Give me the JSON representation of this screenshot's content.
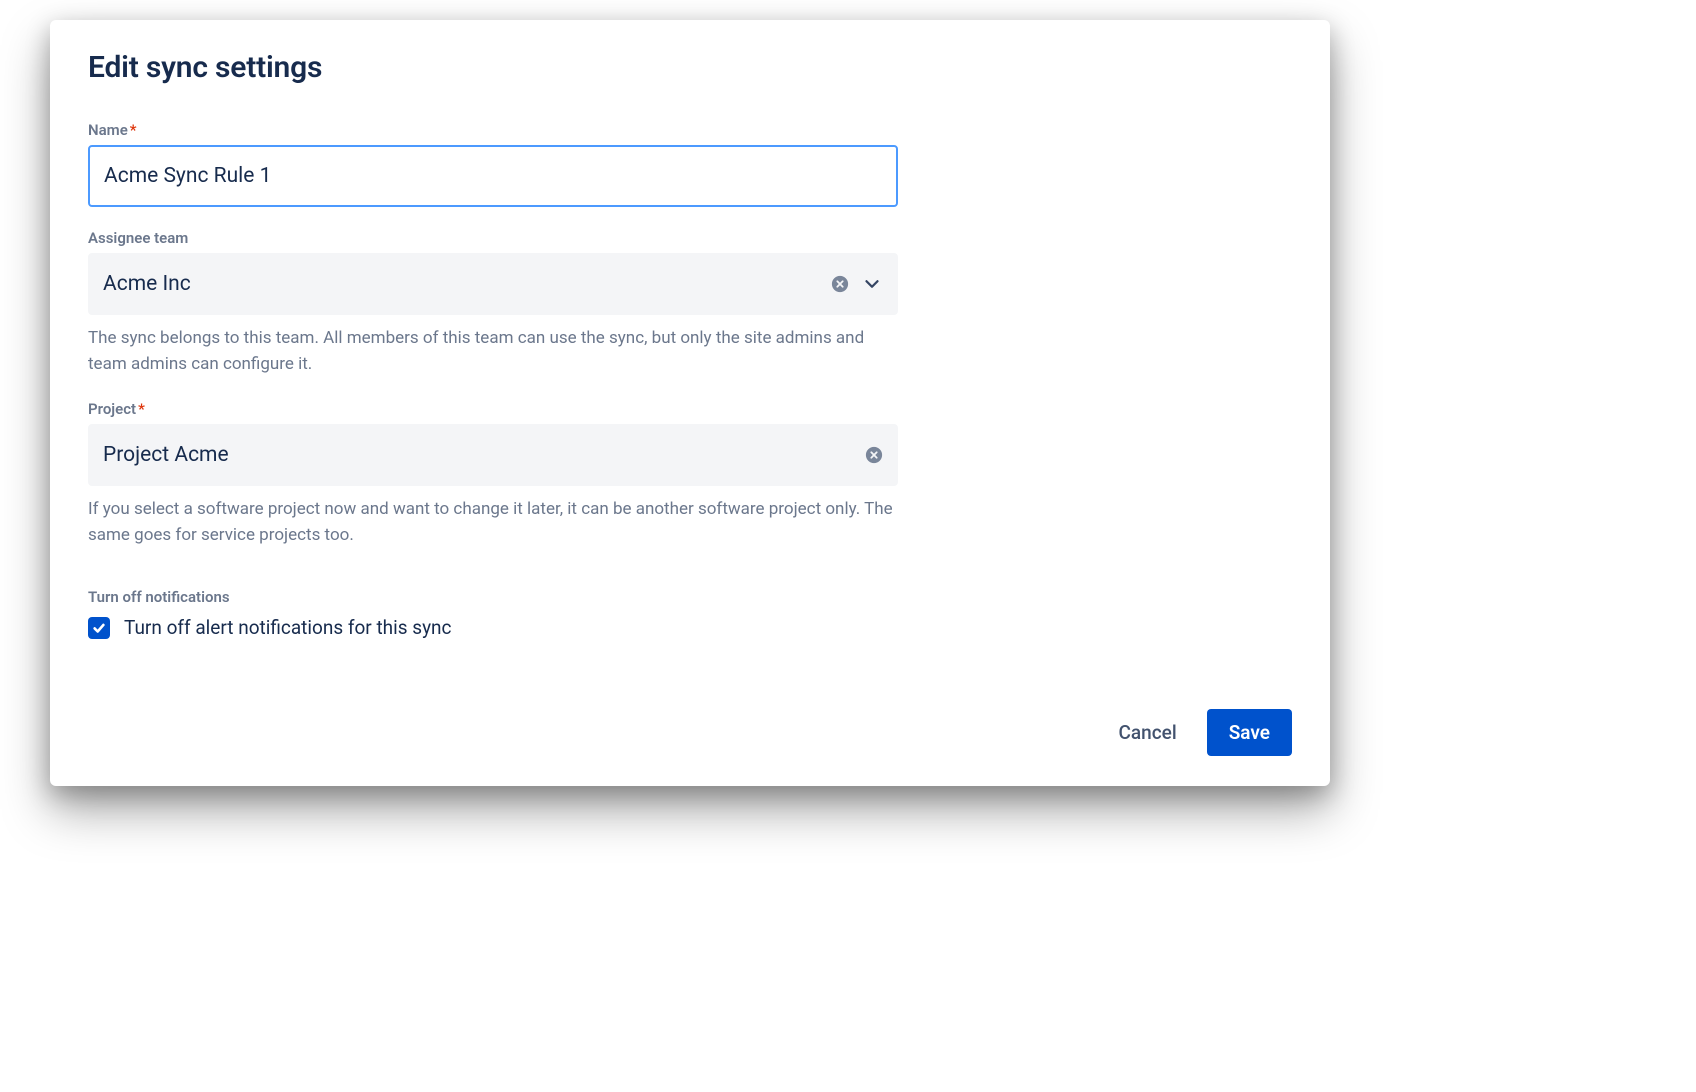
{
  "modal": {
    "title": "Edit sync settings"
  },
  "fields": {
    "name": {
      "label": "Name",
      "required_marker": "*",
      "value": "Acme Sync Rule 1"
    },
    "assignee": {
      "label": "Assignee team",
      "value": "Acme Inc",
      "helper": "The sync belongs to this team. All members of this team can use the sync, but only the site admins and team admins can configure it."
    },
    "project": {
      "label": "Project",
      "required_marker": "*",
      "value": "Project Acme",
      "helper": "If you select a software project now and want to change it later, it can be another software project only. The same goes for service projects too."
    },
    "notifications": {
      "section_label": "Turn off notifications",
      "checkbox_label": "Turn off alert notifications for this sync",
      "checked": true
    }
  },
  "footer": {
    "cancel": "Cancel",
    "save": "Save"
  },
  "icons": {
    "clear": "clear-circle-icon",
    "chevron_down": "chevron-down-icon",
    "check": "check-icon"
  }
}
